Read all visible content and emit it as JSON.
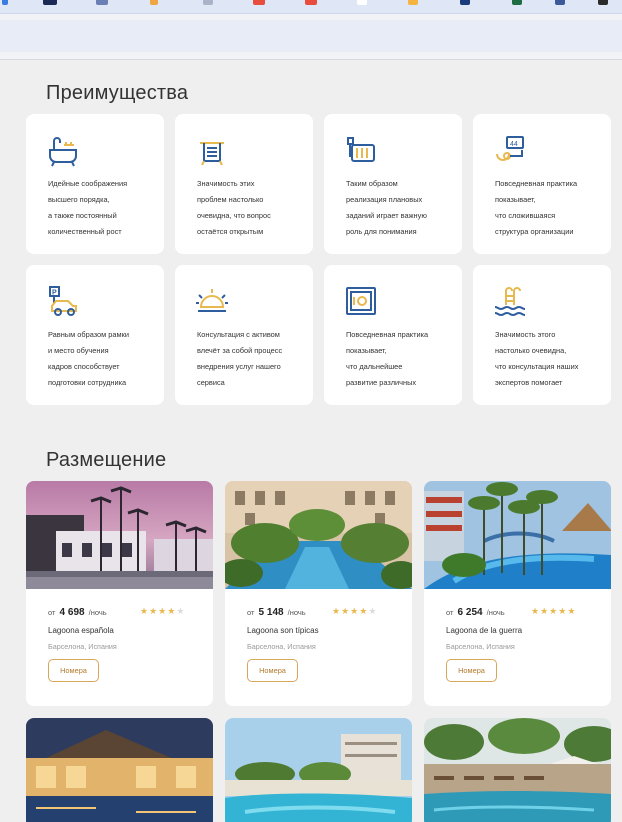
{
  "colors": {
    "accent": "#e8b94f",
    "icon_blue": "#2f5e9e",
    "button_border": "#d8a75a"
  },
  "advantages": {
    "title": "Преимущества",
    "items": [
      {
        "icon": "bathtub-icon",
        "lines": [
          "Идейные соображения",
          "высшего порядка,",
          "а также постоянный",
          "количественный рост"
        ]
      },
      {
        "icon": "towel-icon",
        "lines": [
          "Значимость этих",
          "проблем настолько",
          "очевидна, что вопрос",
          "остаётся открытым"
        ]
      },
      {
        "icon": "heater-icon",
        "lines": [
          "Таким образом",
          "реализация плановых",
          "заданий играет важную",
          "роль для понимания"
        ]
      },
      {
        "icon": "air-conditioner-icon",
        "lines": [
          "Повседневная практика",
          "показывает,",
          "что сложившаяся",
          "структура организации"
        ]
      },
      {
        "icon": "parking-icon",
        "lines": [
          "Равным образом рамки",
          "и место обучения",
          "кадров способствует",
          "подготовки сотрудника"
        ]
      },
      {
        "icon": "room-service-bell-icon",
        "lines": [
          "Консультация с активом",
          "влечёт за собой процесс",
          "внедрения услуг нашего",
          "сервиса"
        ]
      },
      {
        "icon": "safe-icon",
        "lines": [
          "Повседневная практика",
          "показывает,",
          "что дальнейшее",
          "развитие различных"
        ]
      },
      {
        "icon": "pool-icon",
        "lines": [
          "Значимость этого",
          "настолько очевидна,",
          "что консультация наших",
          "экспертов помогает"
        ]
      }
    ]
  },
  "accommodation": {
    "title": "Размещение",
    "hotels": [
      {
        "from": "от",
        "price": "4 698",
        "per": "/ночь",
        "rating": 4,
        "name": "Lagoona española",
        "location": "Барселона, Испания",
        "button": "Номера"
      },
      {
        "from": "от",
        "price": "5 148",
        "per": "/ночь",
        "rating": 4,
        "name": "Lagoona son típicas",
        "location": "Барселона, Испания",
        "button": "Номера"
      },
      {
        "from": "от",
        "price": "6 254",
        "per": "/ночь",
        "rating": 5,
        "name": "Lagoona de la guerra",
        "location": "Барселона, Испания",
        "button": "Номера"
      },
      {
        "image": "hotel-photo"
      },
      {
        "image": "hotel-photo"
      },
      {
        "image": "hotel-photo"
      }
    ]
  }
}
